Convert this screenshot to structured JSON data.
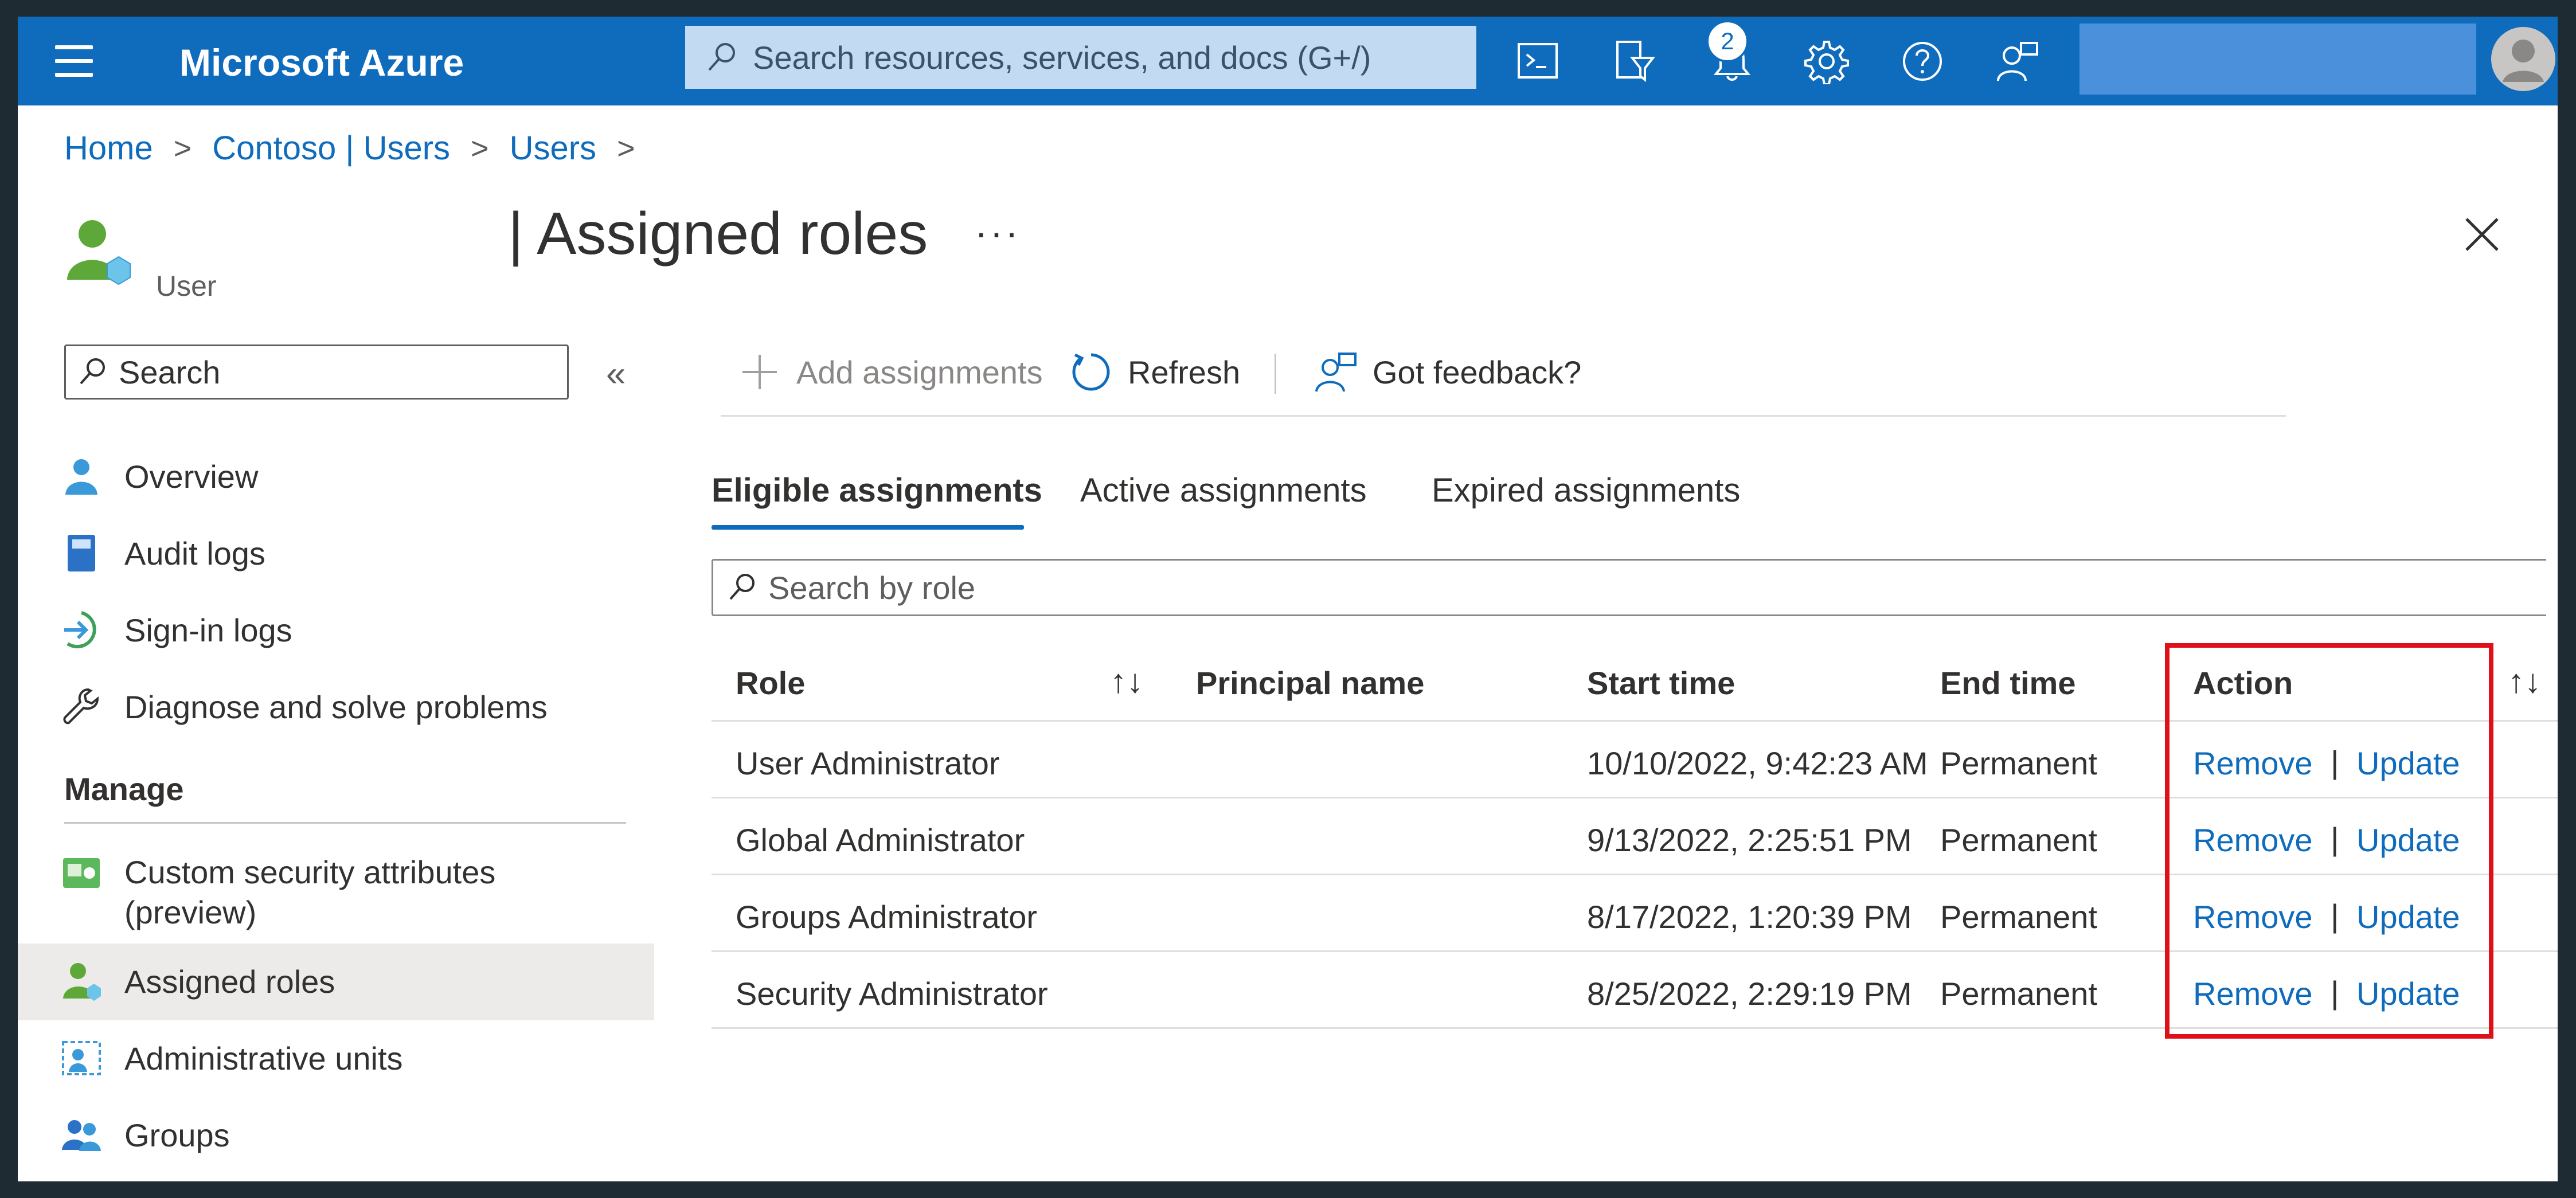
{
  "topbar": {
    "brand": "Microsoft Azure",
    "search_placeholder": "Search resources, services, and docs (G+/)",
    "notification_count": "2",
    "icons": [
      "hamburger-icon",
      "search-icon",
      "cloud-shell-icon",
      "directory-filter-icon",
      "bell-icon",
      "gear-icon",
      "help-icon",
      "feedback-icon",
      "avatar"
    ],
    "accent_color": "#0f6cbd"
  },
  "breadcrumb": [
    "Home",
    "Contoso | Users",
    "Users"
  ],
  "header": {
    "title": "| Assigned roles",
    "subtitle": "User",
    "more": "···"
  },
  "sidebar": {
    "search_placeholder": "Search",
    "collapse": "«",
    "items": [
      {
        "label": "Overview",
        "icon": "user-icon"
      },
      {
        "label": "Audit logs",
        "icon": "book-icon"
      },
      {
        "label": "Sign-in logs",
        "icon": "sign-in-icon"
      },
      {
        "label": "Diagnose and solve problems",
        "icon": "wrench-icon"
      }
    ],
    "section_manage": "Manage",
    "manage_items": [
      {
        "label": "Custom security attributes",
        "label2": "(preview)",
        "icon": "security-attributes-icon"
      },
      {
        "label": "Assigned roles",
        "icon": "user-role-icon",
        "selected": true
      },
      {
        "label": "Administrative units",
        "icon": "admin-units-icon"
      },
      {
        "label": "Groups",
        "icon": "groups-icon"
      }
    ]
  },
  "toolbar": {
    "add_label": "Add assignments",
    "refresh_label": "Refresh",
    "feedback_label": "Got feedback?"
  },
  "tabs": [
    {
      "label": "Eligible assignments",
      "active": true
    },
    {
      "label": "Active assignments",
      "active": false
    },
    {
      "label": "Expired assignments",
      "active": false
    }
  ],
  "role_search_placeholder": "Search by role",
  "table": {
    "columns": [
      "Role",
      "Principal name",
      "Start time",
      "End time",
      "Action"
    ],
    "sort_icon": "↑↓",
    "rows": [
      {
        "role": "User Administrator",
        "principal": "",
        "start": "10/10/2022, 9:42:23 AM",
        "end": "Permanent",
        "remove": "Remove",
        "update": "Update"
      },
      {
        "role": "Global Administrator",
        "principal": "",
        "start": "9/13/2022, 2:25:51 PM",
        "end": "Permanent",
        "remove": "Remove",
        "update": "Update"
      },
      {
        "role": "Groups Administrator",
        "principal": "",
        "start": "8/17/2022, 1:20:39 PM",
        "end": "Permanent",
        "remove": "Remove",
        "update": "Update"
      },
      {
        "role": "Security Administrator",
        "principal": "",
        "start": "8/25/2022, 2:29:19 PM",
        "end": "Permanent",
        "remove": "Remove",
        "update": "Update"
      }
    ],
    "separator": "|"
  },
  "highlight_color": "#e0101a"
}
